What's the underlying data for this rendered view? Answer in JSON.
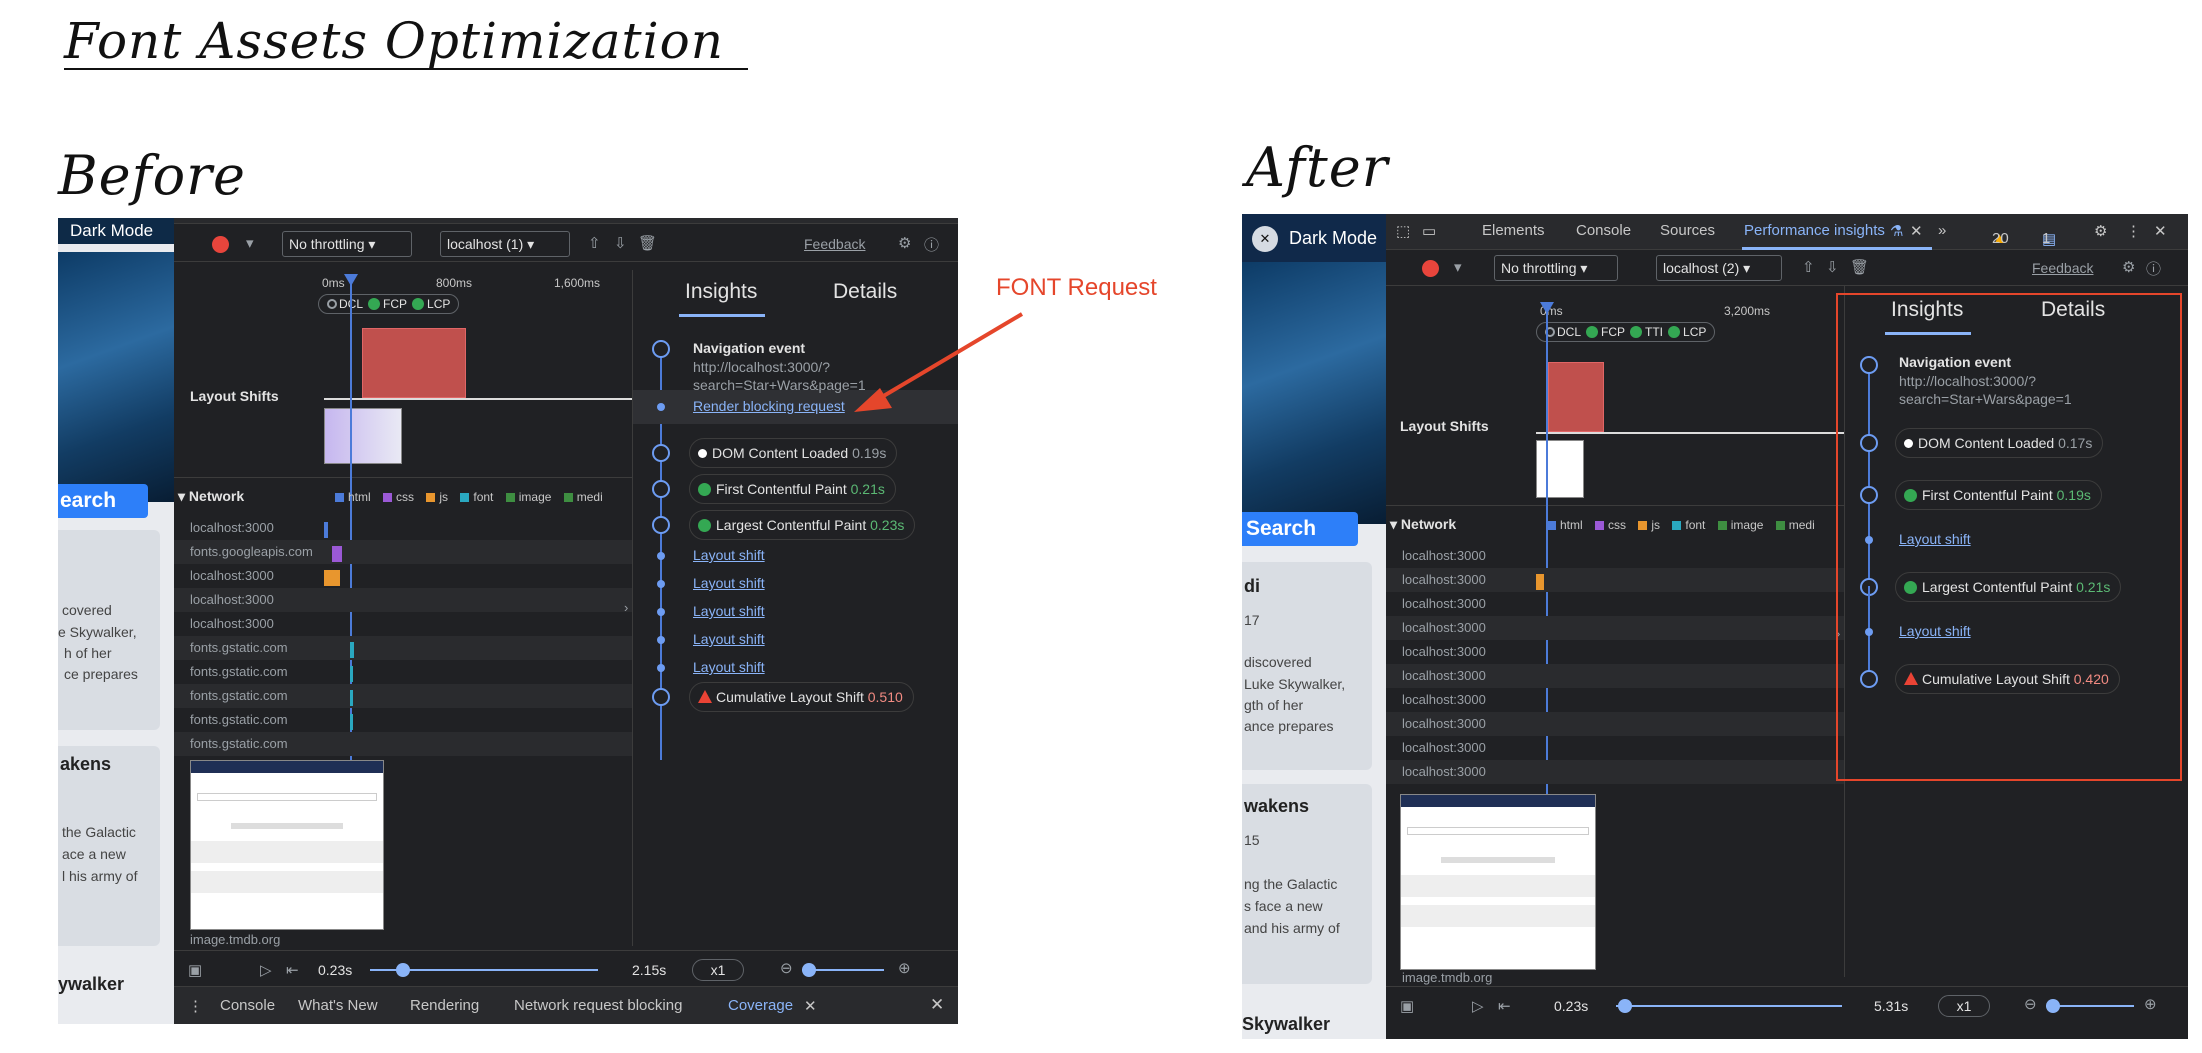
{
  "title": "Font Assets Optimization",
  "before_label": "Before",
  "after_label": "After",
  "annotation": "FONT Request",
  "colors": {
    "annotation": "#e5462b",
    "accent": "#8ab4f8",
    "good": "#5bb974",
    "bad": "#f28b82"
  },
  "before": {
    "page": {
      "header": "Dark Mode",
      "search_button": "earch",
      "card1_lines": [
        "covered",
        "e Skywalker,",
        "h of her",
        "ce prepares"
      ],
      "card2_title": "akens",
      "card2_lines": [
        "the Galactic",
        "ace a new",
        "l his army of"
      ],
      "card3_title": "ywalker"
    },
    "toolbar": {
      "throttle": "No throttling",
      "target": "localhost (1)",
      "feedback": "Feedback"
    },
    "ruler": {
      "t0": "0ms",
      "t1": "800ms",
      "t2": "1,600ms"
    },
    "markers": {
      "dcl": "DCL",
      "fcp": "FCP",
      "lcp": "LCP"
    },
    "layout_shifts_label": "Layout Shifts",
    "network_label": "Network",
    "legend": [
      "html",
      "css",
      "js",
      "font",
      "image",
      "medi"
    ],
    "network_rows": [
      "localhost:3000",
      "fonts.googleapis.com",
      "localhost:3000",
      "localhost:3000",
      "localhost:3000",
      "fonts.gstatic.com",
      "fonts.gstatic.com",
      "fonts.gstatic.com",
      "fonts.gstatic.com",
      "fonts.gstatic.com"
    ],
    "network_last": "image.tmdb.org",
    "bottom": {
      "start": "0.23s",
      "end": "2.15s",
      "speed": "x1"
    },
    "drawer_tabs": [
      "Console",
      "What's New",
      "Rendering",
      "Network request blocking",
      "Coverage"
    ],
    "panel": {
      "tabs": [
        "Insights",
        "Details"
      ],
      "nav_title": "Navigation event",
      "nav_url": [
        "http://localhost:3000/?",
        "search=Star+Wars&page=1"
      ],
      "render_blocking": "Render blocking request",
      "dcl": {
        "label": "DOM Content Loaded",
        "value": "0.19s"
      },
      "fcp": {
        "label": "First Contentful Paint",
        "value": "0.21s"
      },
      "lcp": {
        "label": "Largest Contentful Paint",
        "value": "0.23s"
      },
      "layout_shift": "Layout shift",
      "cls": {
        "label": "Cumulative Layout Shift",
        "value": "0.510"
      }
    }
  },
  "after": {
    "page": {
      "header": "Dark Mode",
      "search_button": "Search",
      "card1_title": "di",
      "card1_sub": "17",
      "card1_lines": [
        "discovered",
        " Luke Skywalker,",
        "gth of her",
        "ance prepares"
      ],
      "card2_title": "wakens",
      "card2_sub": "15",
      "card2_lines": [
        "ng the Galactic",
        "s face a new",
        "and his army of"
      ],
      "card3_title": "Skywalker"
    },
    "tabs": {
      "elements": "Elements",
      "console": "Console",
      "sources": "Sources",
      "perf": "Performance insights",
      "warn_count": "20",
      "msg_count": "1"
    },
    "toolbar": {
      "throttle": "No throttling",
      "target": "localhost (2)",
      "feedback": "Feedback"
    },
    "ruler": {
      "t0": "0ms",
      "t1": "3,200ms"
    },
    "markers": {
      "dcl": "DCL",
      "fcp": "FCP",
      "tti": "TTI",
      "lcp": "LCP"
    },
    "layout_shifts_label": "Layout Shifts",
    "network_label": "Network",
    "legend": [
      "html",
      "css",
      "js",
      "font",
      "image",
      "medi"
    ],
    "network_rows": [
      "localhost:3000",
      "localhost:3000",
      "localhost:3000",
      "localhost:3000",
      "localhost:3000",
      "localhost:3000",
      "localhost:3000",
      "localhost:3000",
      "localhost:3000",
      "localhost:3000"
    ],
    "network_last": "image.tmdb.org",
    "bottom": {
      "start": "0.23s",
      "end": "5.31s",
      "speed": "x1"
    },
    "panel": {
      "tabs": [
        "Insights",
        "Details"
      ],
      "nav_title": "Navigation event",
      "nav_url": [
        "http://localhost:3000/?",
        "search=Star+Wars&page=1"
      ],
      "dcl": {
        "label": "DOM Content Loaded",
        "value": "0.17s"
      },
      "fcp": {
        "label": "First Contentful Paint",
        "value": "0.19s"
      },
      "layout_shift": "Layout shift",
      "lcp": {
        "label": "Largest Contentful Paint",
        "value": "0.21s"
      },
      "cls": {
        "label": "Cumulative Layout Shift",
        "value": "0.420"
      }
    }
  }
}
